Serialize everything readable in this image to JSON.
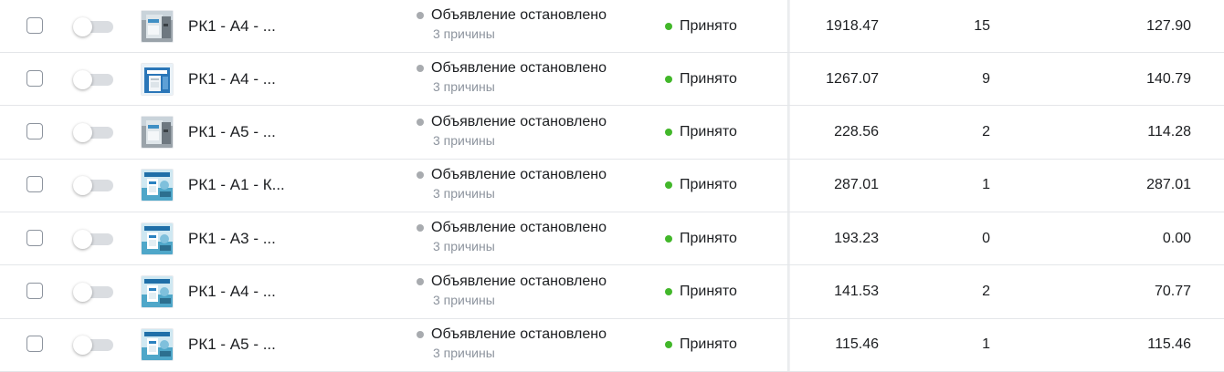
{
  "colors": {
    "stopped_dot": "#a8abaf",
    "accepted_dot": "#42b72a",
    "row_border": "#e4e6e9",
    "muted_text": "#8d949e"
  },
  "rows": [
    {
      "name": "РК1 - А4 - ...",
      "thumbnail": "product-photo-gray",
      "delivery_status": "Объявление остановлено",
      "delivery_reason": "3 причины",
      "review_status": "Принято",
      "spent": "1918.47",
      "results": "15",
      "cost_per_result": "127.90",
      "toggle_on": false,
      "checked": false
    },
    {
      "name": "РК1 - А4 - ...",
      "thumbnail": "product-photo-blue-box",
      "delivery_status": "Объявление остановлено",
      "delivery_reason": "3 причины",
      "review_status": "Принято",
      "spent": "1267.07",
      "results": "9",
      "cost_per_result": "140.79",
      "toggle_on": false,
      "checked": false
    },
    {
      "name": "РК1 - А5 - ...",
      "thumbnail": "product-photo-gray",
      "delivery_status": "Объявление остановлено",
      "delivery_reason": "3 причины",
      "review_status": "Принято",
      "spent": "228.56",
      "results": "2",
      "cost_per_result": "114.28",
      "toggle_on": false,
      "checked": false
    },
    {
      "name": "РК1 - А1 - К...",
      "thumbnail": "product-photo-teal",
      "delivery_status": "Объявление остановлено",
      "delivery_reason": "3 причины",
      "review_status": "Принято",
      "spent": "287.01",
      "results": "1",
      "cost_per_result": "287.01",
      "toggle_on": false,
      "checked": false
    },
    {
      "name": "РК1 - А3 - ...",
      "thumbnail": "product-photo-teal",
      "delivery_status": "Объявление остановлено",
      "delivery_reason": "3 причины",
      "review_status": "Принято",
      "spent": "193.23",
      "results": "0",
      "cost_per_result": "0.00",
      "toggle_on": false,
      "checked": false
    },
    {
      "name": "РК1 - А4 - ...",
      "thumbnail": "product-photo-teal",
      "delivery_status": "Объявление остановлено",
      "delivery_reason": "3 причины",
      "review_status": "Принято",
      "spent": "141.53",
      "results": "2",
      "cost_per_result": "70.77",
      "toggle_on": false,
      "checked": false
    },
    {
      "name": "РК1 - А5 - ...",
      "thumbnail": "product-photo-teal",
      "delivery_status": "Объявление остановлено",
      "delivery_reason": "3 причины",
      "review_status": "Принято",
      "spent": "115.46",
      "results": "1",
      "cost_per_result": "115.46",
      "toggle_on": false,
      "checked": false
    }
  ]
}
